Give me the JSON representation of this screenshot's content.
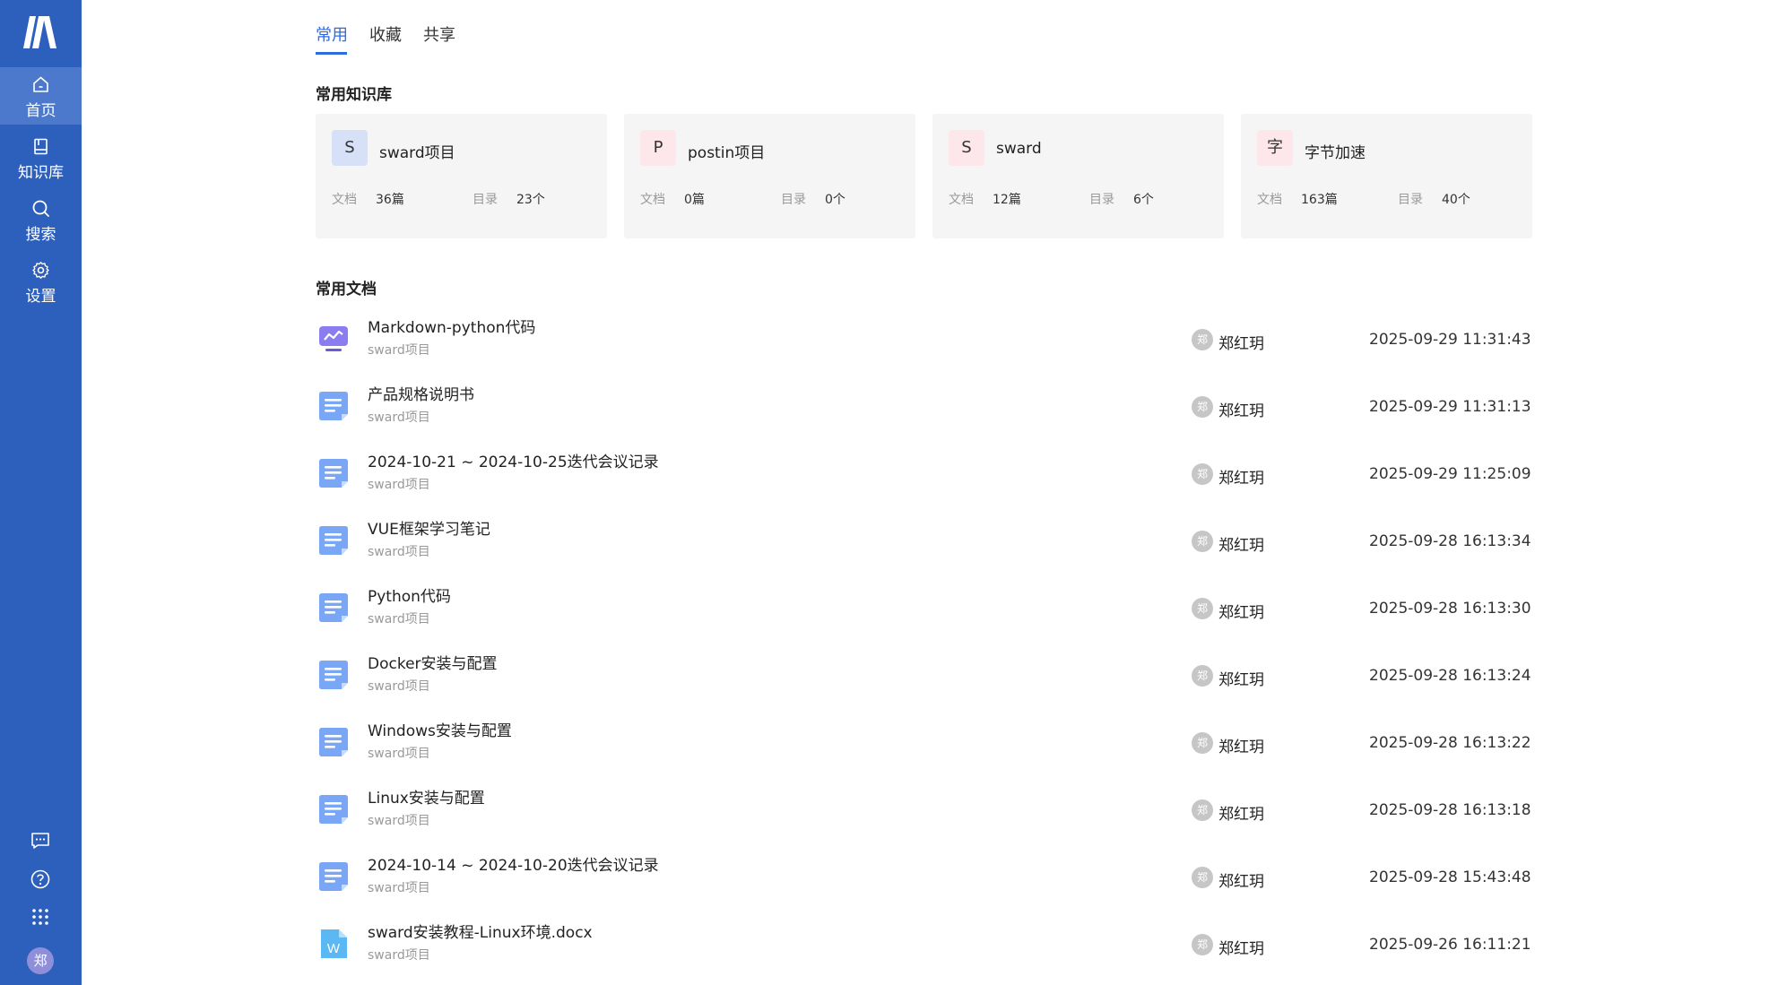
{
  "sidebar": {
    "logo": "logo-icon",
    "nav": [
      {
        "label": "首页",
        "icon": "home-icon",
        "active": true
      },
      {
        "label": "知识库",
        "icon": "book-icon",
        "active": false
      },
      {
        "label": "搜索",
        "icon": "search-icon",
        "active": false
      },
      {
        "label": "设置",
        "icon": "gear-icon",
        "active": false
      }
    ],
    "bottom_icons": [
      "message-icon",
      "help-icon",
      "apps-grid-icon"
    ],
    "user_avatar": "郑"
  },
  "tabs": [
    {
      "label": "常用",
      "active": true
    },
    {
      "label": "收藏",
      "active": false
    },
    {
      "label": "共享",
      "active": false
    }
  ],
  "repos_title": "常用知识库",
  "repos": [
    {
      "initial": "S",
      "name": "sward项目",
      "doc_label": "文档",
      "doc_count": "36篇",
      "dir_label": "目录",
      "dir_count": "23个",
      "icon_bg": "#d6e1f7"
    },
    {
      "initial": "P",
      "name": "postin项目",
      "doc_label": "文档",
      "doc_count": "0篇",
      "dir_label": "目录",
      "dir_count": "0个",
      "icon_bg": "#fde7ea"
    },
    {
      "initial": "S",
      "name": "sward",
      "doc_label": "文档",
      "doc_count": "12篇",
      "dir_label": "目录",
      "dir_count": "6个",
      "icon_bg": "#fde7ea"
    },
    {
      "initial": "字",
      "name": "字节加速",
      "doc_label": "文档",
      "doc_count": "163篇",
      "dir_label": "目录",
      "dir_count": "40个",
      "icon_bg": "#fde7ea"
    }
  ],
  "docs_title": "常用文档",
  "docs": [
    {
      "title": "Markdown-python代码",
      "repo": "sward项目",
      "author_initial": "郑",
      "author": "郑红玥",
      "time": "2025-09-29 11:31:43",
      "type": "markdown-icon"
    },
    {
      "title": "产品规格说明书",
      "repo": "sward项目",
      "author_initial": "郑",
      "author": "郑红玥",
      "time": "2025-09-29 11:31:13",
      "type": "document-icon"
    },
    {
      "title": "2024-10-21 ~ 2024-10-25迭代会议记录",
      "repo": "sward项目",
      "author_initial": "郑",
      "author": "郑红玥",
      "time": "2025-09-29 11:25:09",
      "type": "document-icon"
    },
    {
      "title": "VUE框架学习笔记",
      "repo": "sward项目",
      "author_initial": "郑",
      "author": "郑红玥",
      "time": "2025-09-28 16:13:34",
      "type": "document-icon"
    },
    {
      "title": "Python代码",
      "repo": "sward项目",
      "author_initial": "郑",
      "author": "郑红玥",
      "time": "2025-09-28 16:13:30",
      "type": "document-icon"
    },
    {
      "title": "Docker安装与配置",
      "repo": "sward项目",
      "author_initial": "郑",
      "author": "郑红玥",
      "time": "2025-09-28 16:13:24",
      "type": "document-icon"
    },
    {
      "title": "Windows安装与配置",
      "repo": "sward项目",
      "author_initial": "郑",
      "author": "郑红玥",
      "time": "2025-09-28 16:13:22",
      "type": "document-icon"
    },
    {
      "title": "Linux安装与配置",
      "repo": "sward项目",
      "author_initial": "郑",
      "author": "郑红玥",
      "time": "2025-09-28 16:13:18",
      "type": "document-icon"
    },
    {
      "title": "2024-10-14 ~ 2024-10-20迭代会议记录",
      "repo": "sward项目",
      "author_initial": "郑",
      "author": "郑红玥",
      "time": "2025-09-28 15:43:48",
      "type": "document-icon"
    },
    {
      "title": "sward安装教程-Linux环境.docx",
      "repo": "sward项目",
      "author_initial": "郑",
      "author": "郑红玥",
      "time": "2025-09-26 16:11:21",
      "type": "word-file-icon"
    }
  ],
  "colors": {
    "sidebar": "#2d5fbd",
    "accent": "#2d6be0",
    "doc_icon": "#7aa7f5"
  }
}
